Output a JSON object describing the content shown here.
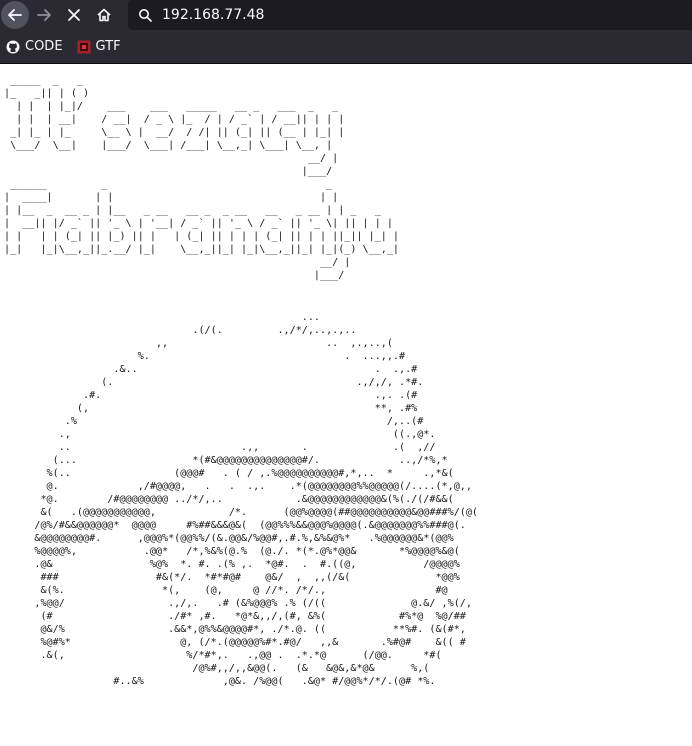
{
  "browser": {
    "url": "192.168.77.48",
    "bookmarks": [
      {
        "label": "CODE",
        "icon": "github-icon"
      },
      {
        "label": "GTF",
        "icon": "gtf-favicon-icon"
      }
    ]
  },
  "page": {
    "banner_lines": [
      " _____  _   _",
      "|_   _|| | ( )",
      "  | |  | |_|/    ___    ___   _____   __ _   ___  _   _",
      "  | |  | __|    / __|  / _ \\ |_  / | / _` | / __|| | | |",
      " _| |_ | |_     \\__ \\ |  __/  / /| || (_| || (__ | |_| |",
      " \\___/  \\__|    |___/  \\___| /___| \\__,_| \\___| \\__, |",
      "                                                  __/ |",
      "                                                 |___/",
      " ______         _                                    _",
      "|  ____|       | |                                  | |",
      "| |__  _  __ _ | |__   _ __   __ _  _ __   __   _ __ | | _   _",
      "|  __|| |/ _` || '_ \\ | '__| / _` || '_ \\ / _` || '_ \\| || | | |",
      "| |   | | (_| || |_) || |   | (_| || | | | (_| || | | ||_|| |_| |",
      "|_|   |_|\\__,_||_.__/ |_|    \\__,_||_| |_|\\__,_||_| |_|(_) \\__,_|",
      "                                                    __/ |",
      "                                                   |___/"
    ],
    "art_lines": [
      "                                                 ...",
      "                               .(/(.         .,/*/,..,.,..",
      "                         ,,                          ..  ,.,..,(",
      "                      %.                                .  ...,,.#",
      "                  .&..                                       .  .,.#",
      "                (.                                        .,/,/, .*#.",
      "             .#.                                             .,. .(#",
      "            (,                                               **, .#%",
      "          .%                                                   /,..(#",
      "         .,                                                     ((.,@*.",
      "         ..                            .,,       .              .(  ,//",
      "        (...                   *(#&@@@@@@@@@@@@@@#/.             ..,/*%,*",
      "       %(..                 (@@@#   . ( / ,.%@@@@@@@@@@#,*,..  *     .,*&(",
      "       @.             ,/#@@@@,   .   .  .,.    .*(@@@@@@@@%%@@@@@(/....(*,@,,",
      "      *@.        /#@@@@@@@@ ../*/,..            .&@@@@@@@@@@@@&(%(./(/#&&(",
      "      &(   .(@@@@@@@@@@@,            /*.      (@@%@@@@(##@@@@@@@@@@&@@###%/(@(",
      "     /@%/#&&@@@@@@*  @@@@     #%##&&&@&(  (@@%%%&&@@@%@@@@(.&@@@@@@@%%###@(.",
      "     &@@@@@@@@#.      ,@@@%*(@@%%/(&.@@&/%@@#,.#.%,&%&@%*   .%@@@@@@&*(@@%",
      "     %@@@@%,           .@@*   /*,%&%(@.%  (@./. *(*.@%*@@&       *%@@@@%&@(",
      "     .@&                %@%  *. #. .(% ,.  *@#.  .  #.((@,           /@@@@%",
      "      ###                #&(*/.  *#*#@#    @&/  ,  ,,(/&(              *@@%",
      "      &(%.                *(,    (@,     @ //*. /*/.,                  #@",
      "     ,%@@/                 .,/,.   .# (&%@@@% .% (/((              @.&/ ,%(/,",
      "      (#                   ./#* ,#.   *@*&,,/,(#, &%(            #%*@  %@/##",
      "      @&/%                 .&&*,@%%&@@@@#*, ./*.@. ((           **%#. (&(#*,",
      "      %@#%*                  @, (/*.(@@@@@%#*.#@/   ,,&       .%#@#    &(( #",
      "      .&(,                    %/*#*,.   .,@@ .  .*.*@      (/@@.     *#(",
      "                               /@%#,,/,,&@@(.   (&   &@&,&*@&      %,(",
      "                  #..&%             ,@&. /%@@(   .&@* #/@@%*/*/.(@# *%."
    ]
  }
}
